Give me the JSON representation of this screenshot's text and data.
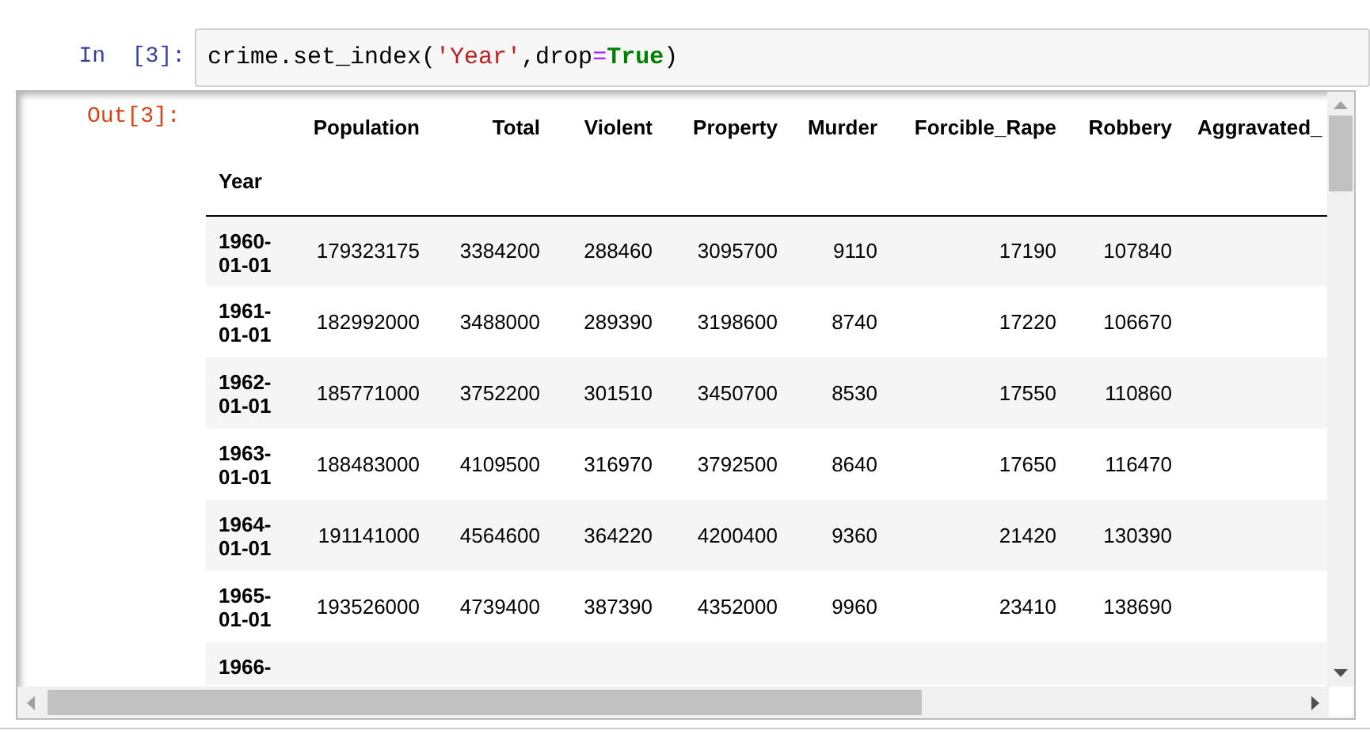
{
  "input_prompt": "In  [3]:",
  "code": [
    {
      "kind": "plain",
      "text": "crime.set_index("
    },
    {
      "kind": "string",
      "text": "'Year'"
    },
    {
      "kind": "plain",
      "text": ",drop"
    },
    {
      "kind": "operator",
      "text": "="
    },
    {
      "kind": "keyword",
      "text": "True"
    },
    {
      "kind": "plain",
      "text": ")"
    }
  ],
  "output_prompt": "Out[3]:",
  "table": {
    "columns": [
      "Population",
      "Total",
      "Violent",
      "Property",
      "Murder",
      "Forcible_Rape",
      "Robbery",
      "Aggravated_"
    ],
    "index_name": "Year",
    "rows": [
      {
        "year": "1960-01-01",
        "cells": [
          "179323175",
          "3384200",
          "288460",
          "3095700",
          "9110",
          "17190",
          "107840"
        ]
      },
      {
        "year": "1961-01-01",
        "cells": [
          "182992000",
          "3488000",
          "289390",
          "3198600",
          "8740",
          "17220",
          "106670"
        ]
      },
      {
        "year": "1962-01-01",
        "cells": [
          "185771000",
          "3752200",
          "301510",
          "3450700",
          "8530",
          "17550",
          "110860"
        ]
      },
      {
        "year": "1963-01-01",
        "cells": [
          "188483000",
          "4109500",
          "316970",
          "3792500",
          "8640",
          "17650",
          "116470"
        ]
      },
      {
        "year": "1964-01-01",
        "cells": [
          "191141000",
          "4564600",
          "364220",
          "4200400",
          "9360",
          "21420",
          "130390"
        ]
      },
      {
        "year": "1965-01-01",
        "cells": [
          "193526000",
          "4739400",
          "387390",
          "4352000",
          "9960",
          "23410",
          "138690"
        ]
      },
      {
        "year": "1966-",
        "cells": []
      }
    ]
  }
}
